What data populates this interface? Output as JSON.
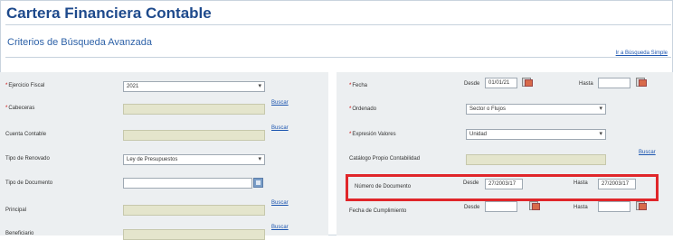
{
  "app": {
    "title": "Cartera Financiera Contable",
    "subtitle": "Criterios de Búsqueda Avanzada",
    "quick_search_link": "Ir a Búsqueda Simple"
  },
  "left": {
    "ejercicio_fiscal": {
      "label": "Ejercicio Fiscal",
      "value": "2021"
    },
    "cabeceras": {
      "label": "Cabeceras",
      "value": "",
      "link": "Buscar"
    },
    "cuenta_contable": {
      "label": "Cuenta Contable",
      "value": "",
      "link": "Buscar"
    },
    "tipo_renovado": {
      "label": "Tipo de Renovado",
      "value": "Ley de Presupuestos"
    },
    "tipo_documento": {
      "label": "Tipo de Documento",
      "value": ""
    },
    "principal": {
      "label": "Principal",
      "value": "",
      "link": "Buscar"
    },
    "beneficiario": {
      "label": "Beneficiario",
      "value": "",
      "link": "Buscar"
    }
  },
  "right": {
    "fecha": {
      "label": "Fecha",
      "desde_label": "Desde",
      "desde_value": "01/01/21",
      "hasta_label": "Hasta",
      "hasta_value": ""
    },
    "ordenado": {
      "label": "Ordenado",
      "value": "Sector o Flujos"
    },
    "expresion_valores": {
      "label": "Expresión Valores",
      "value": "Unidad"
    },
    "catalogo": {
      "label": "Catálogo Propio Contabilidad",
      "value": "",
      "link": "Buscar"
    },
    "numero_documento": {
      "label": "Número de Documento",
      "desde_label": "Desde",
      "desde_value": "27/2003/17",
      "hasta_label": "Hasta",
      "hasta_value": "27/2003/17"
    },
    "fecha_cumplimiento": {
      "label": "Fecha de Cumplimiento",
      "desde_label": "Desde",
      "desde_value": "",
      "hasta_label": "Hasta",
      "hasta_value": ""
    }
  },
  "colors": {
    "title": "#1e4a8c",
    "highlight": "#e0262a",
    "panel": "#eceff1",
    "readonly": "#e4e5cc"
  }
}
